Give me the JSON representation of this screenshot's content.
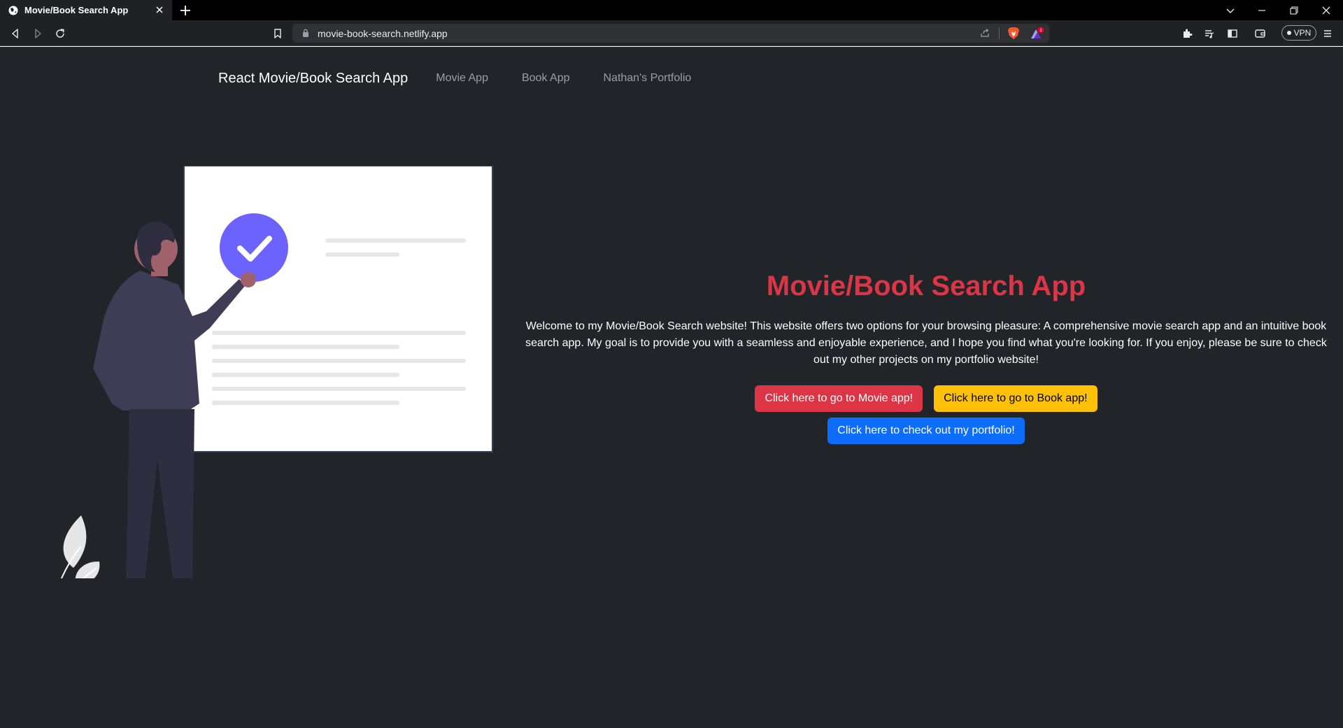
{
  "browser": {
    "tab_title": "Movie/Book Search App",
    "url": "movie-book-search.netlify.app",
    "vpn_label": "VPN",
    "icons": [
      "globe-icon",
      "close-icon",
      "plus-icon",
      "chevron-down-icon",
      "minimize-icon",
      "restore-icon",
      "back-icon",
      "forward-icon",
      "reload-icon",
      "bookmark-icon",
      "lock-icon",
      "share-icon",
      "brave-shield-icon",
      "brave-rewards-icon",
      "extensions-icon",
      "playlist-icon",
      "sidebar-icon",
      "wallet-icon",
      "menu-icon"
    ]
  },
  "navbar": {
    "brand": "React Movie/Book Search App",
    "links": [
      "Movie App",
      "Book App",
      "Nathan's Portfolio"
    ]
  },
  "hero": {
    "title": "Movie/Book Search App",
    "description": "Welcome to my Movie/Book Search website! This website offers two options for your browsing pleasure: A comprehensive movie search app and an intuitive book search app. My goal is to provide you with a seamless and enjoyable experience, and I hope you find what you're looking for. If you enjoy, please be sure to check out my other projects on my portfolio website!",
    "buttons": {
      "movie": "Click here to go to Movie app!",
      "book": "Click here to go to Book app!",
      "portfolio": "Click here to check out my portfolio!"
    }
  },
  "colors": {
    "page_bg": "#212529",
    "title": "#dc3545",
    "btn_red": "#dc3545",
    "btn_yellow": "#ffc107",
    "btn_blue": "#0d6efd",
    "accent_purple": "#6c63ff"
  }
}
